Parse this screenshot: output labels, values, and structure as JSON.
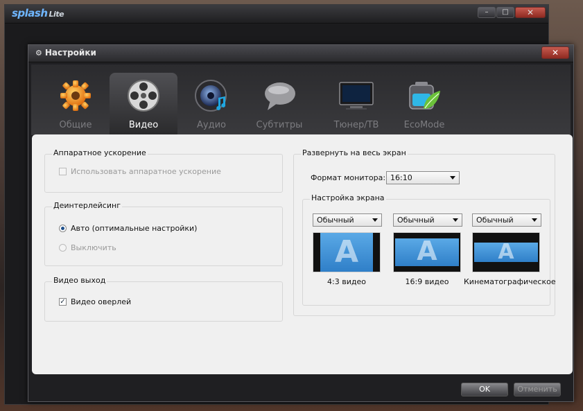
{
  "background_app": {
    "logo_main": "splash",
    "logo_sub": "Lite",
    "controls": {
      "minimize": "–",
      "maximize": "□",
      "close": "✕"
    }
  },
  "dialog": {
    "title": "Настройки",
    "close_glyph": "✕"
  },
  "tabs": [
    {
      "label": "Общие",
      "icon": "gear-icon",
      "active": false
    },
    {
      "label": "Видео",
      "icon": "film-reel-icon",
      "active": true
    },
    {
      "label": "Аудио",
      "icon": "speaker-icon",
      "active": false
    },
    {
      "label": "Субтитры",
      "icon": "speech-bubble-icon",
      "active": false
    },
    {
      "label": "Тюнер/ТВ",
      "icon": "tv-icon",
      "active": false
    },
    {
      "label": "EcoMode",
      "icon": "battery-leaf-icon",
      "active": false
    }
  ],
  "hw_accel": {
    "title": "Аппаратное ускорение",
    "checkbox_label": "Использовать аппаратное ускорение",
    "checked": false
  },
  "deinterlace": {
    "title": "Деинтерлейсинг",
    "option_auto": "Авто (оптимальные настройки)",
    "option_off": "Выключить"
  },
  "video_out": {
    "title": "Видео выход",
    "checkbox_label": "Видео оверлей",
    "checked": true
  },
  "fullscreen": {
    "title": "Развернуть на весь экран",
    "monitor_format_label": "Формат монитора:",
    "monitor_format_value": "16:10",
    "screen_setup_title": "Настройка экрана",
    "modes": [
      {
        "select_value": "Обычный",
        "caption": "4:3 видео"
      },
      {
        "select_value": "Обычный",
        "caption": "16:9 видео"
      },
      {
        "select_value": "Обычный",
        "caption": "Кинематографическое"
      }
    ],
    "preview_letter": "A"
  },
  "buttons": {
    "ok": "OK",
    "cancel": "Отменить"
  },
  "colors": {
    "accent_blue": "#2f7fc8",
    "close_red": "#b5463b",
    "panel_bg": "#f0f0f0"
  }
}
